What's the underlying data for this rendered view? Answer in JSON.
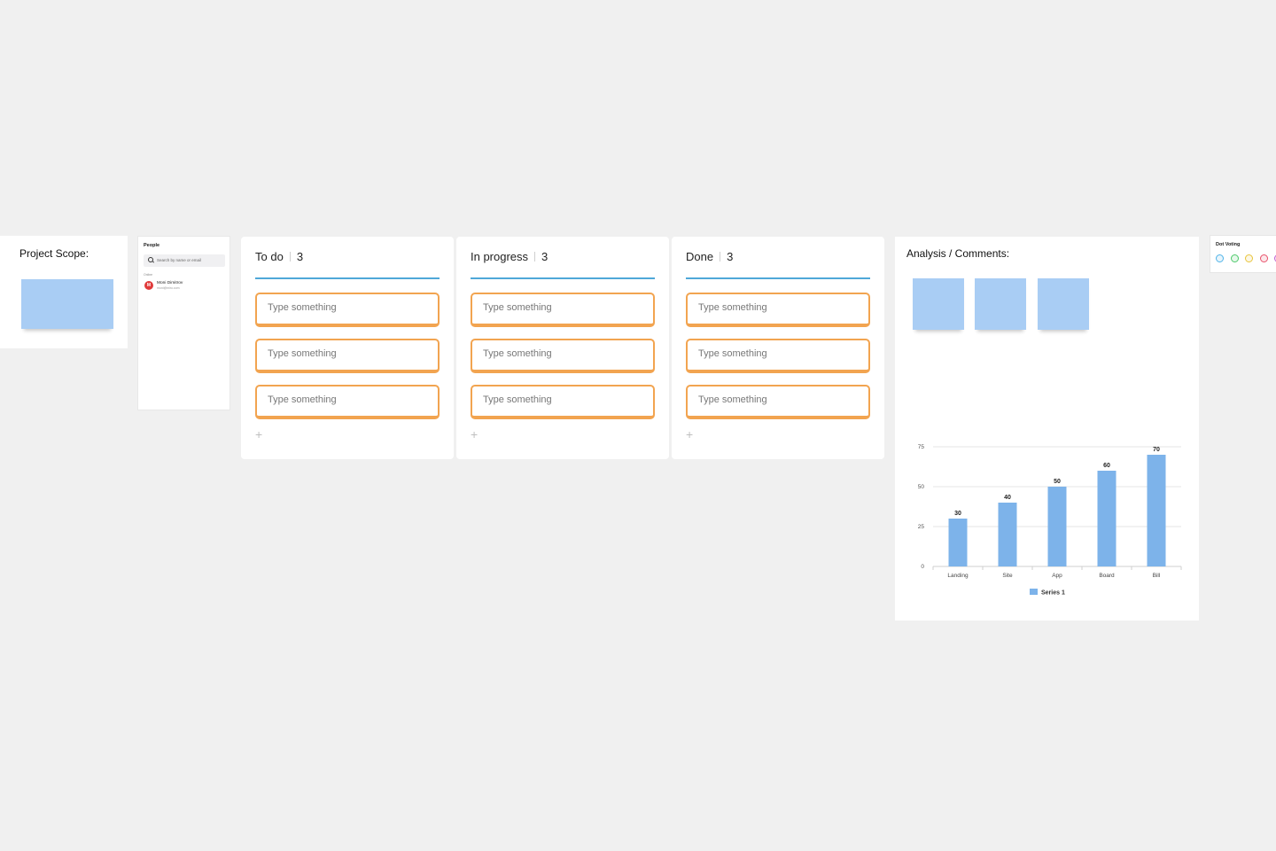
{
  "project_scope": {
    "title": "Project Scope:"
  },
  "people": {
    "title": "People",
    "search_placeholder": "Search by name or email",
    "online_label": "Online",
    "users": [
      {
        "initial": "M",
        "name": "Moni Dimitrov",
        "email": "moni@miro.com"
      }
    ]
  },
  "kanban": {
    "columns": [
      {
        "name": "To do",
        "count": "3",
        "cards": [
          "Type something",
          "Type something",
          "Type something"
        ],
        "add": "+"
      },
      {
        "name": "In progress",
        "count": "3",
        "cards": [
          "Type something",
          "Type something",
          "Type something"
        ],
        "add": "+"
      },
      {
        "name": "Done",
        "count": "3",
        "cards": [
          "Type something",
          "Type something",
          "Type something"
        ],
        "add": "+"
      }
    ]
  },
  "analysis": {
    "title": "Analysis / Comments:"
  },
  "dot_voting": {
    "title": "Dot Voting",
    "dots": [
      {
        "color": "#4fb3e8",
        "name": "blue-vote-dot"
      },
      {
        "color": "#4cc96a",
        "name": "green-vote-dot"
      },
      {
        "color": "#e8c43a",
        "name": "yellow-vote-dot"
      },
      {
        "color": "#e8506a",
        "name": "red-vote-dot"
      },
      {
        "color": "#c060d0",
        "name": "purple-vote-dot"
      }
    ]
  },
  "colors": {
    "sticky": "#a9cdf4",
    "card_border": "#f2a450",
    "column_line": "#4fa8d8",
    "bar": "#7db3ea"
  },
  "chart_data": {
    "type": "bar",
    "categories": [
      "Landing",
      "Site",
      "App",
      "Board",
      "Bill"
    ],
    "series": [
      {
        "name": "Series 1",
        "values": [
          30,
          40,
          50,
          60,
          70
        ]
      }
    ],
    "yticks": [
      0,
      25,
      50,
      75
    ],
    "ylim": [
      0,
      75
    ],
    "grid": true,
    "legend": "bottom",
    "data_labels": true
  }
}
